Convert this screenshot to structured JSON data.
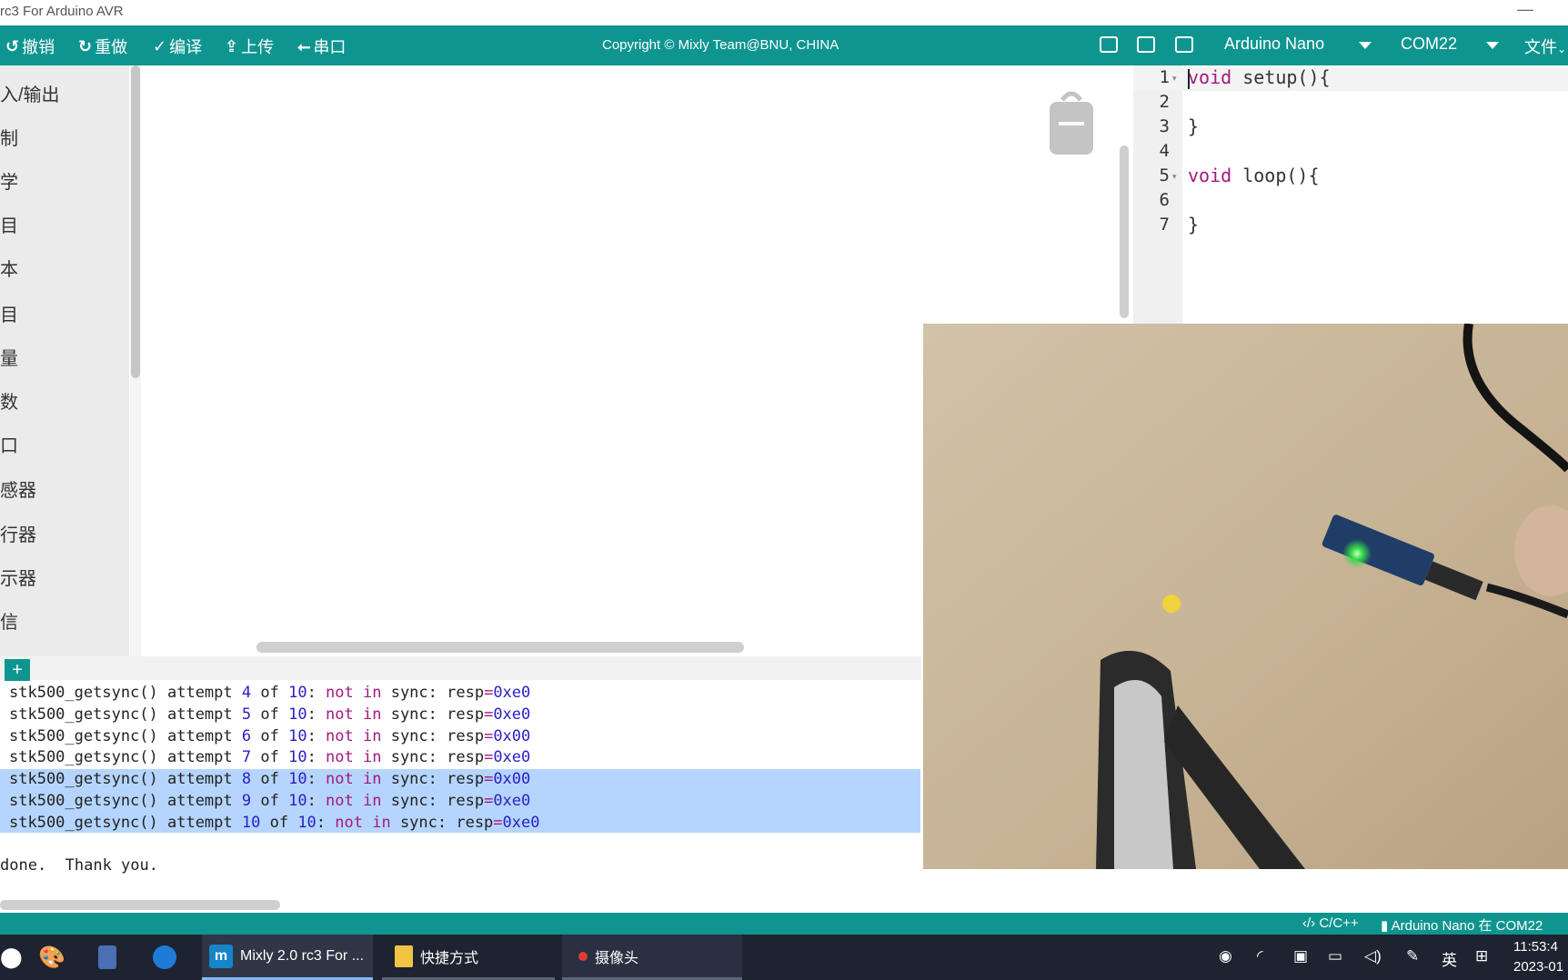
{
  "window": {
    "title": "rc3 For Arduino AVR",
    "minimize": "—"
  },
  "toolbar": {
    "undo": "撤销",
    "redo": "重做",
    "compile": "编译",
    "upload": "上传",
    "serial": "串口",
    "copyright": "Copyright © Mixly Team@BNU, CHINA",
    "board": "Arduino Nano",
    "port": "COM22",
    "file_menu": "文件"
  },
  "sidebar": {
    "categories": [
      "入/输出",
      "制",
      "学",
      "目",
      "本",
      "目",
      "量",
      "数",
      "口",
      "感器",
      "行器",
      "示器",
      "信"
    ]
  },
  "code": {
    "line_numbers": [
      "1",
      "2",
      "3",
      "4",
      "5",
      "6",
      "7"
    ],
    "lines": [
      {
        "kw": "void",
        "rest": " setup(){"
      },
      {
        "kw": "",
        "rest": ""
      },
      {
        "kw": "",
        "rest": "}"
      },
      {
        "kw": "",
        "rest": ""
      },
      {
        "kw": "void",
        "rest": " loop(){"
      },
      {
        "kw": "",
        "rest": ""
      },
      {
        "kw": "",
        "rest": "}"
      }
    ]
  },
  "console": {
    "add": "+",
    "lines": [
      {
        "pre": "stk500_getsync() attempt ",
        "n1": "4",
        "of": " of ",
        "n2": "10",
        "colon": ": ",
        "notin": "not in",
        "sync": " sync: resp",
        "eq": "=",
        "resp": "0xe0"
      },
      {
        "pre": "stk500_getsync() attempt ",
        "n1": "5",
        "of": " of ",
        "n2": "10",
        "colon": ": ",
        "notin": "not in",
        "sync": " sync: resp",
        "eq": "=",
        "resp": "0xe0"
      },
      {
        "pre": "stk500_getsync() attempt ",
        "n1": "6",
        "of": " of ",
        "n2": "10",
        "colon": ": ",
        "notin": "not in",
        "sync": " sync: resp",
        "eq": "=",
        "resp": "0x00"
      },
      {
        "pre": "stk500_getsync() attempt ",
        "n1": "7",
        "of": " of ",
        "n2": "10",
        "colon": ": ",
        "notin": "not in",
        "sync": " sync: resp",
        "eq": "=",
        "resp": "0xe0"
      },
      {
        "pre": "stk500_getsync() attempt ",
        "n1": "8",
        "of": " of ",
        "n2": "10",
        "colon": ": ",
        "notin": "not in",
        "sync": " sync: resp",
        "eq": "=",
        "resp": "0x00"
      },
      {
        "pre": "stk500_getsync() attempt ",
        "n1": "9",
        "of": " of ",
        "n2": "10",
        "colon": ": ",
        "notin": "not in",
        "sync": " sync: resp",
        "eq": "=",
        "resp": "0xe0"
      },
      {
        "pre": "stk500_getsync() attempt ",
        "n1": "10",
        "of": " of ",
        "n2": "10",
        "colon": ": ",
        "notin": "not in",
        "sync": " sync: resp",
        "eq": "=",
        "resp": "0xe0"
      }
    ],
    "done": "done.  Thank you."
  },
  "statusbar": {
    "language": "C/C++",
    "board_status": "Arduino Nano 在 COM22"
  },
  "taskbar": {
    "tasks": [
      "Mixly 2.0 rc3 For ...",
      "快捷方式",
      "摄像头"
    ],
    "ime": "英",
    "time": "11:53:4",
    "date": "2023-01"
  },
  "colors": {
    "accent": "#0f9590",
    "keyword": "#a3197e",
    "number": "#2a1ec8",
    "selection": "#b5d5fe"
  }
}
